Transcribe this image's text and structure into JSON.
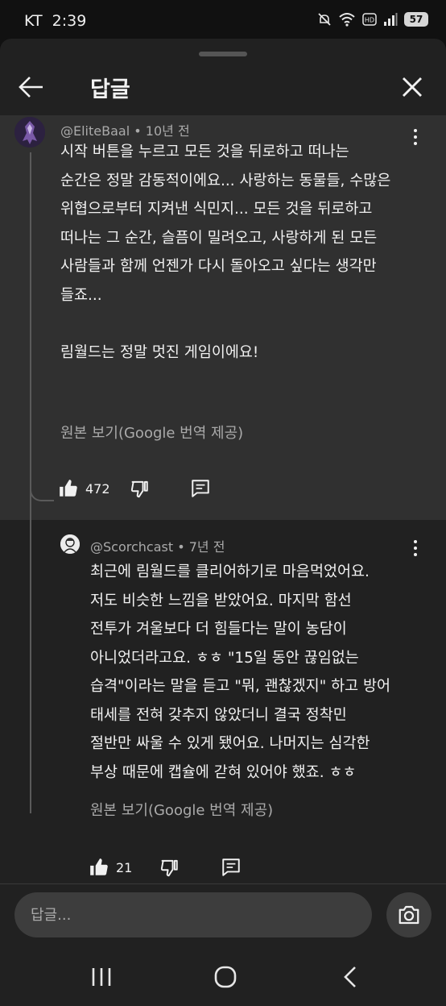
{
  "status_bar": {
    "carrier": "KT",
    "time": "2:39",
    "battery": "57"
  },
  "header": {
    "title": "답글"
  },
  "parent_comment": {
    "author": "@EliteBaal",
    "age": "10년 전",
    "text": "시작 버튼을 누르고 모든 것을 뒤로하고 떠나는\n순간은 정말 감동적이에요... 사랑하는 동물들, 수많은\n위협으로부터 지켜낸 식민지... 모든 것을 뒤로하고\n떠나는 그 순간, 슬픔이 밀려오고, 사랑하게 된 모든\n사람들과 함께 언젠가 다시 돌아오고 싶다는 생각만\n들죠...\n\n림월드는 정말 멋진 게임이에요!",
    "translate_label": "원본 보기(Google 번역 제공)",
    "likes": "472"
  },
  "reply_comment": {
    "author": "@Scorchcast",
    "age": "7년 전",
    "text": "최근에 림월드를 클리어하기로 마음먹었어요.\n저도 비슷한 느낌을 받았어요. 마지막 함선\n전투가 겨울보다 더 힘들다는 말이 농담이\n아니었더라고요. ㅎㅎ \"15일 동안 끊임없는\n습격\"이라는 말을 듣고 \"뭐, 괜찮겠지\" 하고 방어\n태세를 전혀 갖추지 않았더니 결국 정착민\n절반만 싸울 수 있게 됐어요. 나머지는 심각한\n부상 때문에 캡슐에 갇혀 있어야 했죠. ㅎㅎ",
    "translate_label": "원본 보기(Google 번역 제공)",
    "likes": "21"
  },
  "reply_input": {
    "placeholder": "답글..."
  },
  "icons": {
    "back": "arrow-left-icon",
    "close": "close-icon",
    "more": "more-vertical-icon",
    "like": "thumb-up-icon",
    "dislike": "thumb-down-icon",
    "reply": "comment-icon",
    "camera": "camera-icon",
    "nav_recents": "recents-icon",
    "nav_home": "home-icon",
    "nav_back": "nav-back-icon"
  },
  "colors": {
    "background": "#0f0f0f",
    "sheet": "#212121",
    "highlighted_comment": "#303030",
    "secondary_text": "#aaaaaa"
  }
}
